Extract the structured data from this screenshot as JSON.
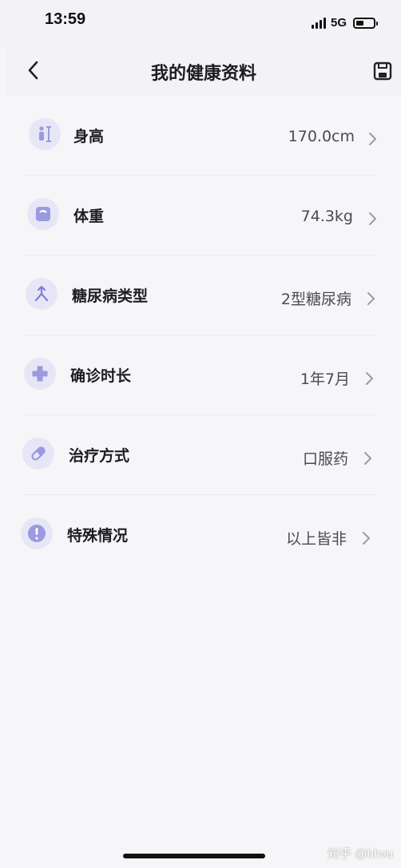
{
  "status_bar": {
    "time": "13:59",
    "network": "5G",
    "battery_level_fraction": 0.45
  },
  "header": {
    "back_icon": "chevron-left-icon",
    "title": "我的健康资料",
    "save_icon": "save-icon"
  },
  "items": [
    {
      "label": "身高",
      "value": "170.0cm",
      "icon": "height-icon"
    },
    {
      "label": "体重",
      "value": "74.3kg",
      "icon": "scale-icon"
    },
    {
      "label": "糖尿病类型",
      "value": "2型糖尿病",
      "icon": "merge-arrow-icon"
    },
    {
      "label": "确诊时长",
      "value": "1年7月",
      "icon": "medical-cross-icon"
    },
    {
      "label": "治疗方式",
      "value": "口服药",
      "icon": "pill-icon"
    },
    {
      "label": "特殊情况",
      "value": "以上皆非",
      "icon": "alert-icon"
    }
  ],
  "watermark": "知乎 @hhvu",
  "colors": {
    "icon_bg": "#e6e6f7",
    "icon_fg": "#9a9adf",
    "background": "#f6f6f8",
    "header_bg": "#f3f3f7"
  }
}
